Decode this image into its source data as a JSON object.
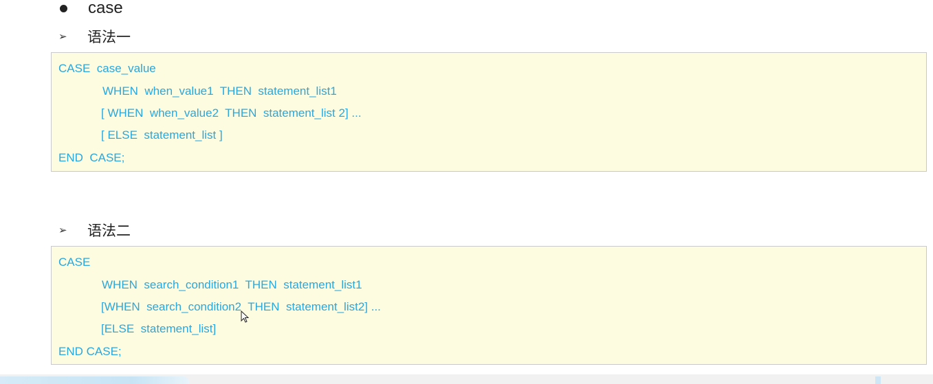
{
  "heading": {
    "bullet_text": "case"
  },
  "syntax1": {
    "label": "语法一",
    "lines": [
      "CASE  case_value",
      "WHEN  when_value1  THEN  statement_list1",
      "[ WHEN  when_value2  THEN  statement_list 2] ...",
      "[ ELSE  statement_list ]",
      "END  CASE;"
    ]
  },
  "syntax2": {
    "label": "语法二",
    "lines": [
      "CASE",
      "WHEN  search_condition1  THEN  statement_list1",
      "[WHEN  search_condition2  THEN  statement_list2] ...",
      "[ELSE  statement_list]",
      "END CASE;"
    ]
  },
  "colors": {
    "code": "#29a8dc",
    "box_bg": "#fdfbe0",
    "box_border": "#c9c9c9"
  },
  "icons": {
    "bullet": "filled-circle",
    "sub_bullet": "arrowhead-right",
    "pointer": "mouse-cursor"
  }
}
